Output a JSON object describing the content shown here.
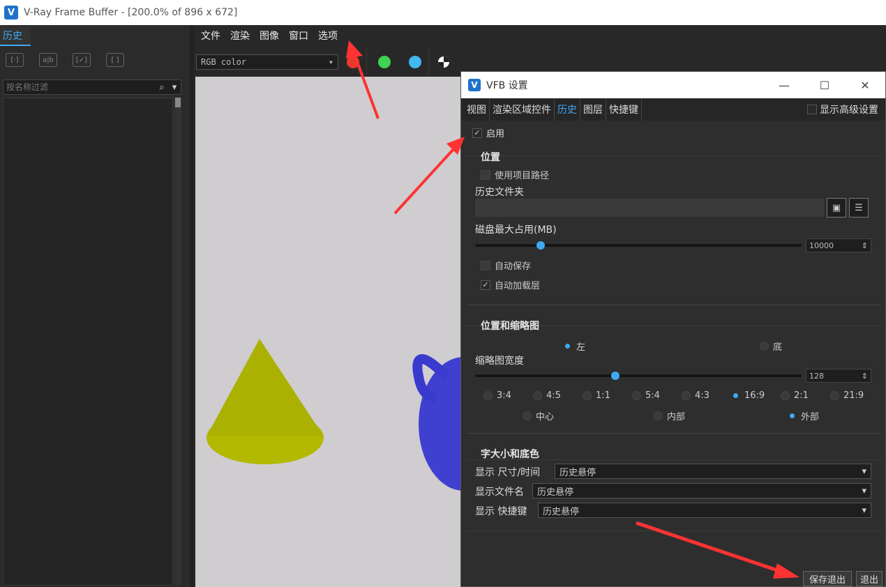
{
  "window": {
    "title": "V-Ray Frame Buffer - [200.0% of 896 x 672]",
    "logo": "V"
  },
  "left_panel": {
    "tab": "历史",
    "tools": [
      "[·]",
      "a|b",
      "[✓]",
      "[ ]"
    ],
    "search_placeholder": "按名称过滤"
  },
  "menubar": [
    "文件",
    "渲染",
    "图像",
    "窗口",
    "选项"
  ],
  "toolbar": {
    "channel": "RGB color",
    "colors": {
      "red": "#e8392b",
      "green": "#3ed353",
      "blue": "#41b8f0"
    }
  },
  "dialog": {
    "title": "VFB 设置",
    "controls": {
      "minimize": "—",
      "maximize": "☐",
      "close": "✕"
    },
    "tabs": [
      "视图",
      "渲染区域控件",
      "历史",
      "图层",
      "快捷键"
    ],
    "active_tab": 2,
    "advanced_label": "显示高级设置",
    "enable_label": "启用",
    "location": {
      "header": "位置",
      "use_project_path": "使用项目路径",
      "history_folder": "历史文件夹",
      "disk_max": "磁盘最大占用(MB)",
      "disk_value": "10000",
      "disk_fraction": 0.2,
      "auto_save": "自动保存",
      "auto_load": "自动加载层"
    },
    "thumbs": {
      "header": "位置和缩略图",
      "pos_left": "左",
      "pos_bottom": "底",
      "width_label": "缩略图宽度",
      "width_value": "128",
      "width_fraction": 0.43,
      "ratios": [
        "3:4",
        "4:5",
        "1:1",
        "5:4",
        "4:3",
        "16:9",
        "2:1",
        "21:9"
      ],
      "ratio_selected": 5,
      "aligns": [
        "中心",
        "内部",
        "外部"
      ],
      "align_selected": 2
    },
    "font": {
      "header": "字大小和底色",
      "rows": [
        {
          "label": "显示 尺寸/时间",
          "value": "历史悬停"
        },
        {
          "label": "显示文件名",
          "value": "历史悬停"
        },
        {
          "label": "显示 快捷键",
          "value": "历史悬停"
        }
      ]
    },
    "buttons": {
      "save_exit": "保存退出",
      "exit": "退出"
    }
  }
}
